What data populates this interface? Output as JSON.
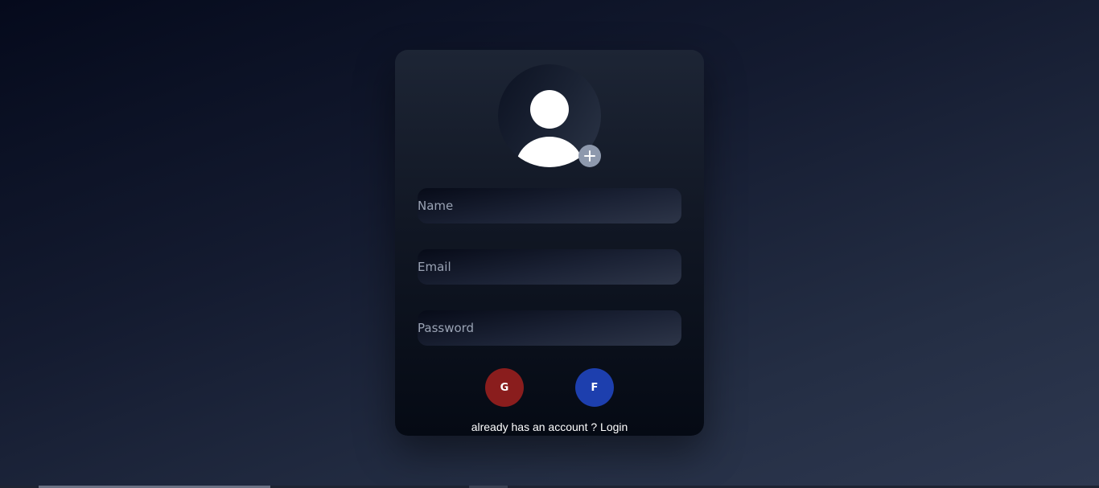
{
  "form": {
    "avatar_icon": "user-icon",
    "add_photo_icon": "plus-icon",
    "fields": {
      "name_placeholder": "Name",
      "email_placeholder": "Email",
      "password_placeholder": "Password"
    },
    "social": {
      "google_label": "G",
      "facebook_label": "F"
    },
    "login_prompt": "already has an account ?",
    "login_link": "Login"
  },
  "colors": {
    "google": "#8a1d1d",
    "facebook": "#1d3fae",
    "add_photo": "#8e99ad"
  }
}
